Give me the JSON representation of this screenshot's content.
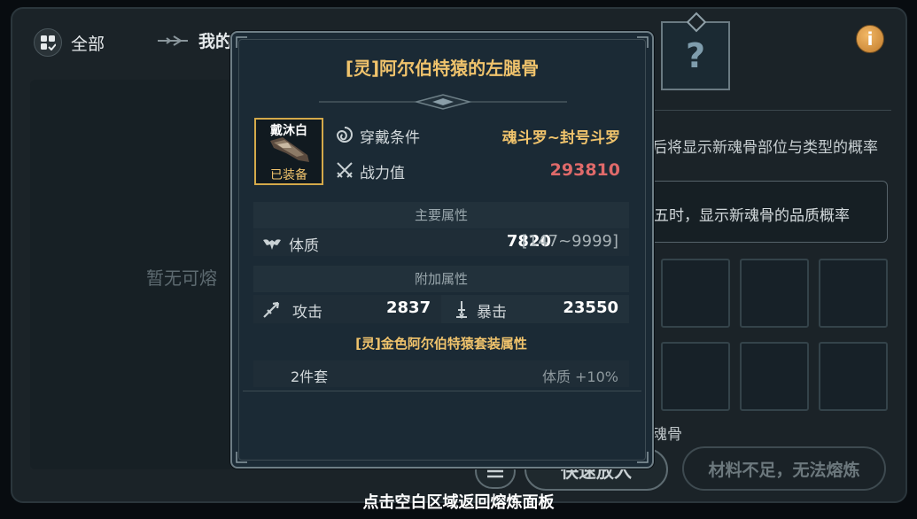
{
  "background": {
    "filter_all": "全部",
    "filter_mine": "我的",
    "empty_text": "暂无可熔",
    "question_mark": "?",
    "info_icon": "i",
    "prob_text1": "后将显示新魂骨部位与类型的概率",
    "prob_text2": "五时，显示新魂骨的品质概率",
    "bone_label": "魂骨",
    "fast_add": "快速放入",
    "insufficient": "材料不足，无法熔炼"
  },
  "tooltip": {
    "title": "[灵]阿尔伯特猿的左腿骨",
    "item_owner": "戴沐白",
    "item_status": "已装备",
    "requirement_label": "穿戴条件",
    "requirement_value": "魂斗罗~封号斗罗",
    "power_label": "战力值",
    "power_value": "293810",
    "main_attr_header": "主要属性",
    "main_attr": {
      "label": "体质",
      "value": "7820",
      "range": "[147~9999]"
    },
    "extra_attr_header": "附加属性",
    "extra_attrs": [
      {
        "label": "攻击",
        "value": "2837"
      },
      {
        "label": "暴击",
        "value": "23550"
      }
    ],
    "set_header": "[灵]金色阿尔伯特猿套装属性",
    "set_bonus": {
      "count": "2件套",
      "effect": "体质 +10%"
    }
  },
  "bottom_hint": "点击空白区域返回熔炼面板",
  "colors": {
    "gold": "#f0c36c",
    "power_red": "#e06a6a",
    "panel_bg": "#1b2a35"
  },
  "icons": [
    "grid-icon",
    "arrow-icon",
    "info-icon",
    "swirl-icon",
    "crossed-swords-icon",
    "muscle-icon",
    "spear-icon",
    "sword-crit-icon",
    "menu-icon"
  ]
}
